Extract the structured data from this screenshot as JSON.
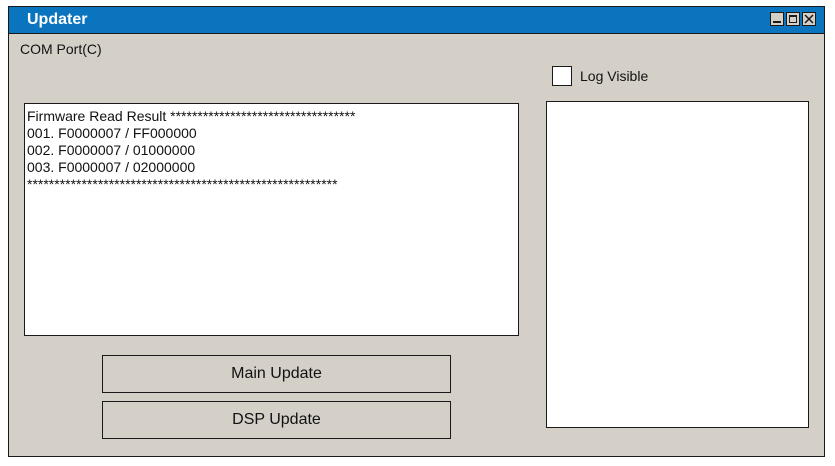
{
  "window": {
    "title": "Updater",
    "controls": [
      "minimize-icon",
      "maximize-icon",
      "close-icon"
    ]
  },
  "menu": {
    "com_port": "COM Port(C)"
  },
  "log": {
    "checkbox_label": "Log Visible",
    "checked": false
  },
  "result": {
    "lines": [
      "Firmware Read Result  **********************************",
      "001. F0000007 / FF000000",
      "002. F0000007 / 01000000",
      "003. F0000007 / 02000000",
      "*********************************************************"
    ]
  },
  "buttons": {
    "main_update": "Main Update",
    "dsp_update": "DSP Update"
  },
  "colors": {
    "titlebar": "#0a74bf",
    "window_bg": "#d4d0c8",
    "panel_bg": "#ffffff"
  }
}
